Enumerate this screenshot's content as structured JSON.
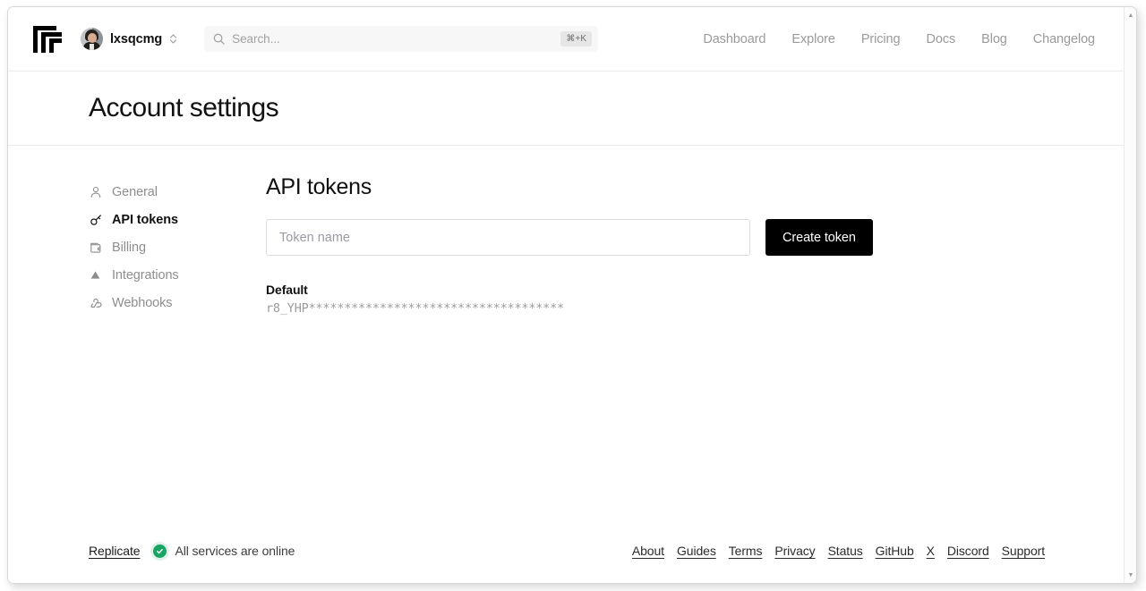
{
  "topnav": {
    "logo_name": "replicate-logo",
    "user": {
      "name": "lxsqcmg"
    },
    "search": {
      "placeholder": "Search...",
      "shortcut": "⌘+K"
    },
    "links": [
      {
        "label": "Dashboard"
      },
      {
        "label": "Explore"
      },
      {
        "label": "Pricing"
      },
      {
        "label": "Docs"
      },
      {
        "label": "Blog"
      },
      {
        "label": "Changelog"
      }
    ]
  },
  "page": {
    "title": "Account settings"
  },
  "sidebar": {
    "items": [
      {
        "label": "General",
        "icon": "person-icon",
        "active": false
      },
      {
        "label": "API tokens",
        "icon": "key-icon",
        "active": true
      },
      {
        "label": "Billing",
        "icon": "wallet-icon",
        "active": false
      },
      {
        "label": "Integrations",
        "icon": "triangle-icon",
        "active": false
      },
      {
        "label": "Webhooks",
        "icon": "webhook-icon",
        "active": false
      }
    ]
  },
  "main": {
    "section_title": "API tokens",
    "token_input": {
      "placeholder": "Token name",
      "value": ""
    },
    "create_button": "Create token",
    "tokens": [
      {
        "name": "Default",
        "value": "r8_YHP************************************"
      }
    ]
  },
  "footer": {
    "brand": "Replicate",
    "status": "All services are online",
    "status_color": "#19a463",
    "links": [
      {
        "label": "About"
      },
      {
        "label": "Guides"
      },
      {
        "label": "Terms"
      },
      {
        "label": "Privacy"
      },
      {
        "label": "Status"
      },
      {
        "label": "GitHub"
      },
      {
        "label": "X"
      },
      {
        "label": "Discord"
      },
      {
        "label": "Support"
      }
    ]
  }
}
